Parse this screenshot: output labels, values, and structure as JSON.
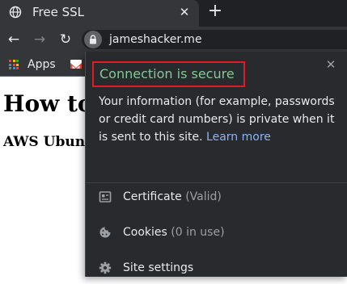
{
  "browser": {
    "tab": {
      "title": "Free SSL",
      "favicon": "globe-icon",
      "close_glyph": "✕"
    },
    "new_tab_glyph": "+",
    "address": {
      "url": "jameshacker.me",
      "lock_icon": "lock-icon"
    },
    "nav": {
      "back_glyph": "←",
      "forward_glyph": "→",
      "reload_glyph": "↻"
    },
    "bookmarks": {
      "apps_label": "Apps",
      "gmail_icon": "gmail-icon"
    },
    "colors": {
      "frame": "#202124",
      "toolbar": "#35363a",
      "popup_bg": "#292a2d",
      "secure_green": "#81c995",
      "link_blue": "#8ab4f8",
      "highlight_red": "#e01b24"
    }
  },
  "page": {
    "heading": "How to",
    "subheading": "AWS Ubuntu"
  },
  "security_popup": {
    "close_glyph": "✕",
    "title": "Connection is secure",
    "body": "Your information (for example, passwords or credit card numbers) is private when it is sent to this site.",
    "learn_more": "Learn more",
    "items": [
      {
        "label": "Certificate",
        "detail": "(Valid)",
        "icon": "certificate-icon"
      },
      {
        "label": "Cookies",
        "detail": "(0 in use)",
        "icon": "cookie-icon"
      },
      {
        "label": "Site settings",
        "detail": "",
        "icon": "gear-icon"
      }
    ]
  }
}
